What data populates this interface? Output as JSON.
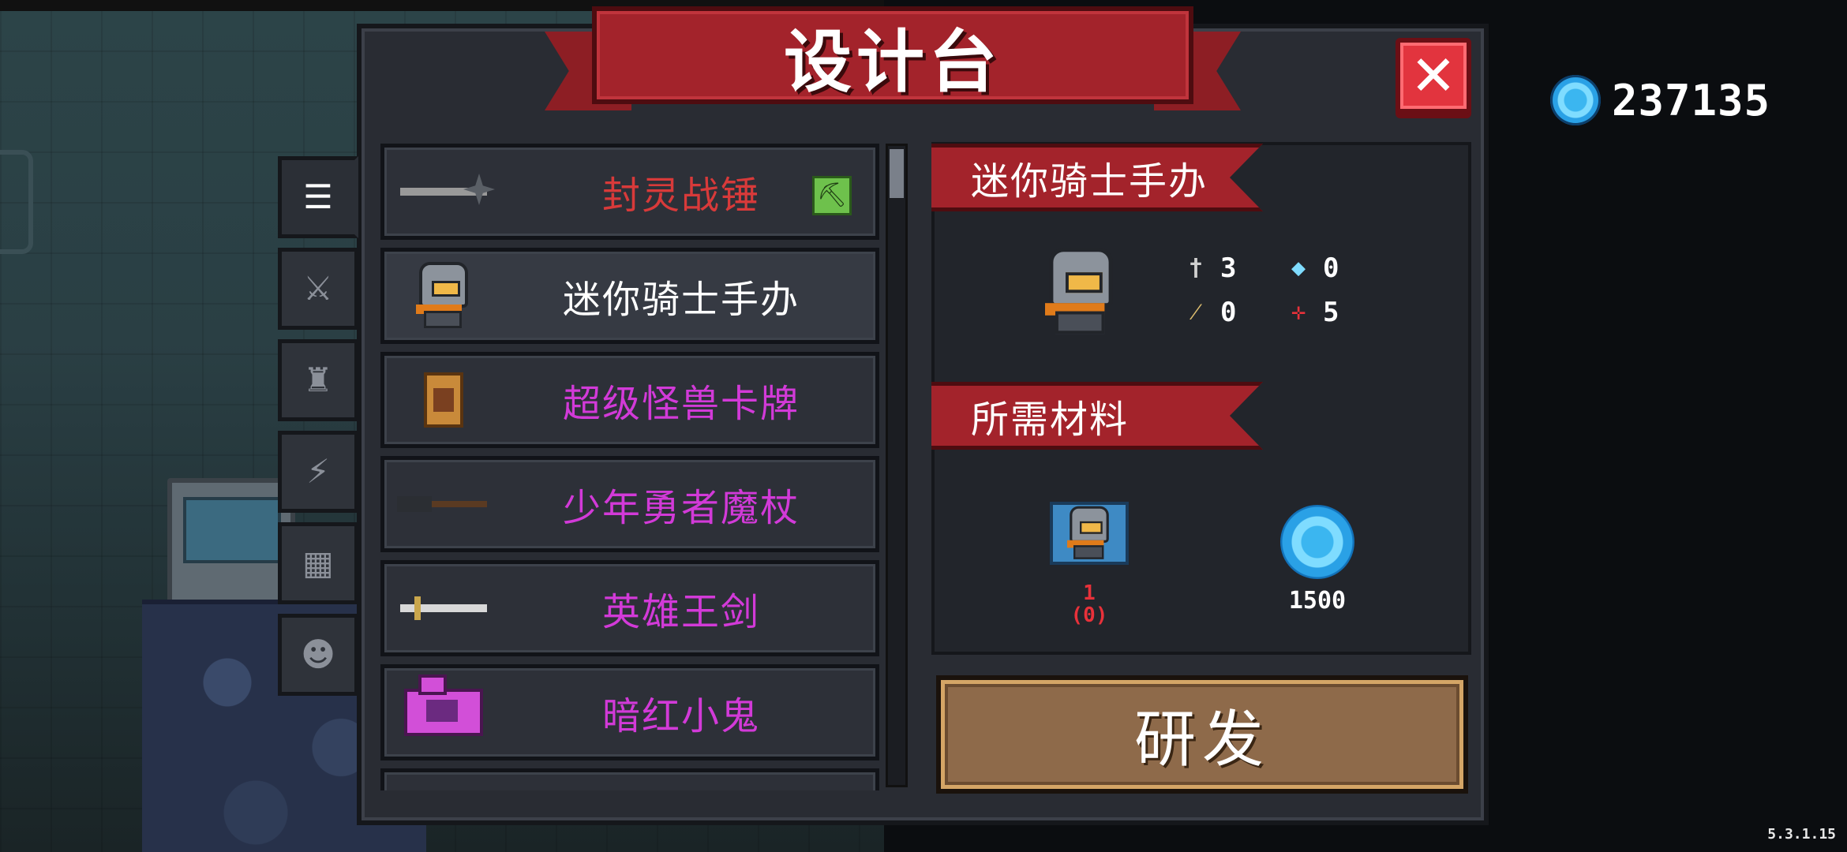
{
  "title": "设计台",
  "close_label": "✕",
  "currency": {
    "icon": "gem-coin-icon",
    "value": "237135"
  },
  "version": "5.3.1.15",
  "side_tabs": [
    {
      "icon": "list-icon",
      "active": true
    },
    {
      "icon": "weapon-icon",
      "active": false
    },
    {
      "icon": "armor-icon",
      "active": false
    },
    {
      "icon": "lightning-icon",
      "active": false
    },
    {
      "icon": "blueprint-icon",
      "active": false
    },
    {
      "icon": "pet-icon",
      "active": false
    }
  ],
  "items": [
    {
      "name": "封灵战锤",
      "color": "#d83a3a",
      "icon": "hammer-icon",
      "badge": "pickaxe-icon"
    },
    {
      "name": "迷你骑士手办",
      "color": "#ffffff",
      "icon": "knight-figure-icon",
      "selected": true
    },
    {
      "name": "超级怪兽卡牌",
      "color": "#d23ad8",
      "icon": "card-icon"
    },
    {
      "name": "少年勇者魔杖",
      "color": "#d23ad8",
      "icon": "staff-icon"
    },
    {
      "name": "英雄王剑",
      "color": "#d23ad8",
      "icon": "sword-icon"
    },
    {
      "name": "暗红小鬼",
      "color": "#d23ad8",
      "icon": "camera-icon"
    }
  ],
  "detail": {
    "name": "迷你骑士手办",
    "stats": {
      "attack": "3",
      "crit": "0",
      "energy": "0",
      "accuracy": "5"
    },
    "materials_title": "所需材料",
    "materials": [
      {
        "icon": "knight-blueprint-icon",
        "count": "1",
        "owned": "(0)"
      },
      {
        "icon": "gem-coin-icon",
        "count": "1500"
      }
    ]
  },
  "research_label": "研发",
  "colors": {
    "ribbon": "#a3232b",
    "panel": "#292c33",
    "button": "#8e6a4a"
  }
}
